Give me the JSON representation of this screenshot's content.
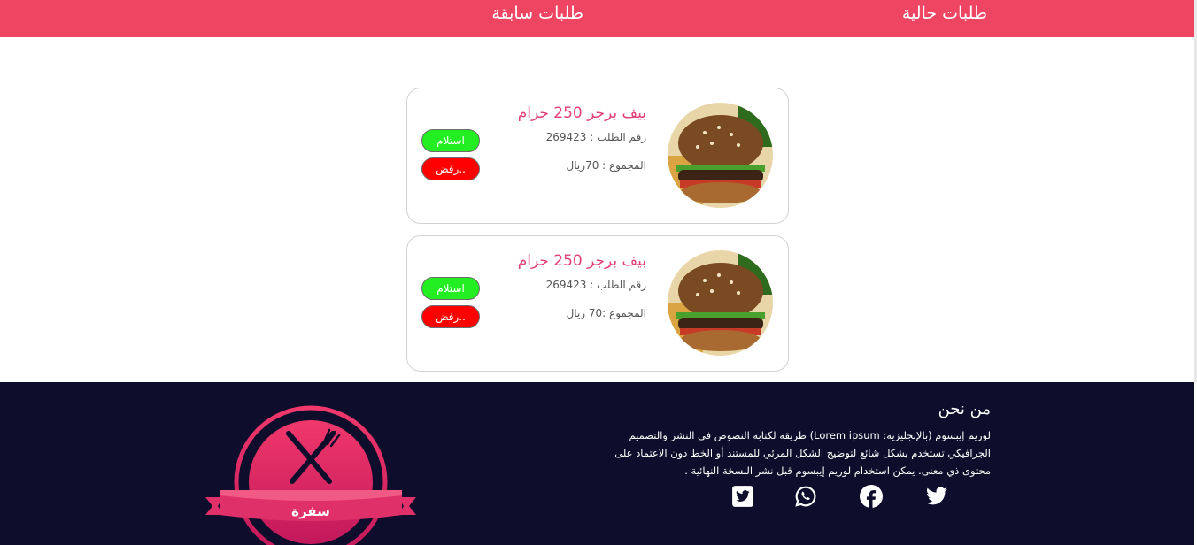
{
  "tabs": {
    "current": "طلبات حالية",
    "previous": "طلبات سابقة"
  },
  "orders": [
    {
      "title": "بيف برجر 250 جرام",
      "order_number": "رقم الطلب : 269423",
      "total": "المجموع : 70ريال",
      "accept_label": "استلام",
      "reject_label": "رفض..",
      "image_icon": "burger-image"
    },
    {
      "title": "بيف برجر 250 جرام",
      "order_number": "رقم الطلب : 269423",
      "total": "المجموع :70 ريال",
      "accept_label": "استلام",
      "reject_label": "رفض..",
      "image_icon": "burger-image"
    }
  ],
  "footer": {
    "about_title": "من نحن",
    "about_text": "لوريم إيبسوم (بالإنجليزية: Lorem ipsum) طريقة لكتابة النصوص في النشر والتصميم الجرافيكي تستخدم بشكل شائع لتوضيح الشكل المرئي للمستند أو الخط دون الاعتماد على محتوى ذي معنى. يمكن استخدام لوريم إيبسوم قبل نشر النسخة النهائية .",
    "logo_text": "سفرة",
    "social_icons": [
      "twitter-icon",
      "facebook-icon",
      "whatsapp-icon",
      "twitter-square-icon"
    ]
  },
  "colors": {
    "brand": "#ee4563",
    "footer_bg": "#0e0d2b",
    "title_pink": "#e1407a",
    "accept_green": "#22ee22",
    "reject_red": "#ff0000"
  }
}
